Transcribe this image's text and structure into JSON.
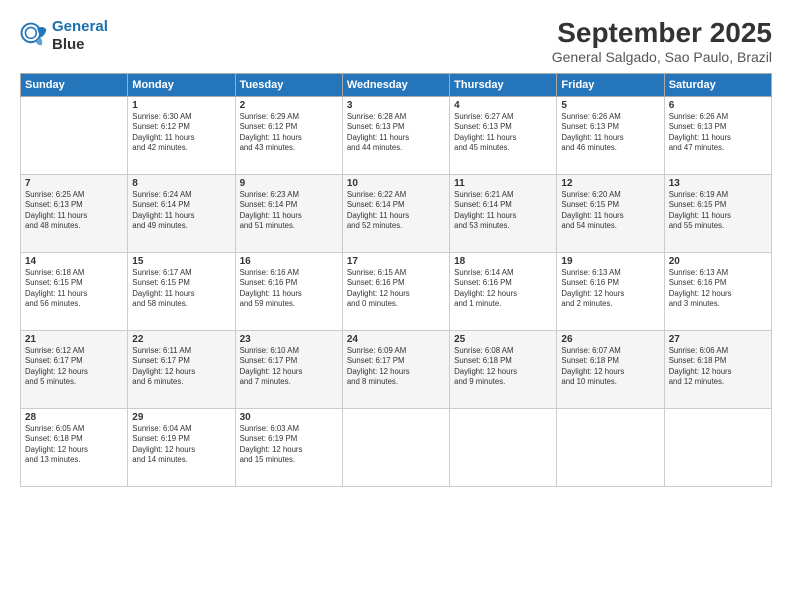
{
  "header": {
    "logo_line1": "General",
    "logo_line2": "Blue",
    "month": "September 2025",
    "location": "General Salgado, Sao Paulo, Brazil"
  },
  "days_of_week": [
    "Sunday",
    "Monday",
    "Tuesday",
    "Wednesday",
    "Thursday",
    "Friday",
    "Saturday"
  ],
  "weeks": [
    [
      {
        "day": "",
        "content": ""
      },
      {
        "day": "1",
        "content": "Sunrise: 6:30 AM\nSunset: 6:12 PM\nDaylight: 11 hours\nand 42 minutes."
      },
      {
        "day": "2",
        "content": "Sunrise: 6:29 AM\nSunset: 6:12 PM\nDaylight: 11 hours\nand 43 minutes."
      },
      {
        "day": "3",
        "content": "Sunrise: 6:28 AM\nSunset: 6:13 PM\nDaylight: 11 hours\nand 44 minutes."
      },
      {
        "day": "4",
        "content": "Sunrise: 6:27 AM\nSunset: 6:13 PM\nDaylight: 11 hours\nand 45 minutes."
      },
      {
        "day": "5",
        "content": "Sunrise: 6:26 AM\nSunset: 6:13 PM\nDaylight: 11 hours\nand 46 minutes."
      },
      {
        "day": "6",
        "content": "Sunrise: 6:26 AM\nSunset: 6:13 PM\nDaylight: 11 hours\nand 47 minutes."
      }
    ],
    [
      {
        "day": "7",
        "content": "Sunrise: 6:25 AM\nSunset: 6:13 PM\nDaylight: 11 hours\nand 48 minutes."
      },
      {
        "day": "8",
        "content": "Sunrise: 6:24 AM\nSunset: 6:14 PM\nDaylight: 11 hours\nand 49 minutes."
      },
      {
        "day": "9",
        "content": "Sunrise: 6:23 AM\nSunset: 6:14 PM\nDaylight: 11 hours\nand 51 minutes."
      },
      {
        "day": "10",
        "content": "Sunrise: 6:22 AM\nSunset: 6:14 PM\nDaylight: 11 hours\nand 52 minutes."
      },
      {
        "day": "11",
        "content": "Sunrise: 6:21 AM\nSunset: 6:14 PM\nDaylight: 11 hours\nand 53 minutes."
      },
      {
        "day": "12",
        "content": "Sunrise: 6:20 AM\nSunset: 6:15 PM\nDaylight: 11 hours\nand 54 minutes."
      },
      {
        "day": "13",
        "content": "Sunrise: 6:19 AM\nSunset: 6:15 PM\nDaylight: 11 hours\nand 55 minutes."
      }
    ],
    [
      {
        "day": "14",
        "content": "Sunrise: 6:18 AM\nSunset: 6:15 PM\nDaylight: 11 hours\nand 56 minutes."
      },
      {
        "day": "15",
        "content": "Sunrise: 6:17 AM\nSunset: 6:15 PM\nDaylight: 11 hours\nand 58 minutes."
      },
      {
        "day": "16",
        "content": "Sunrise: 6:16 AM\nSunset: 6:16 PM\nDaylight: 11 hours\nand 59 minutes."
      },
      {
        "day": "17",
        "content": "Sunrise: 6:15 AM\nSunset: 6:16 PM\nDaylight: 12 hours\nand 0 minutes."
      },
      {
        "day": "18",
        "content": "Sunrise: 6:14 AM\nSunset: 6:16 PM\nDaylight: 12 hours\nand 1 minute."
      },
      {
        "day": "19",
        "content": "Sunrise: 6:13 AM\nSunset: 6:16 PM\nDaylight: 12 hours\nand 2 minutes."
      },
      {
        "day": "20",
        "content": "Sunrise: 6:13 AM\nSunset: 6:16 PM\nDaylight: 12 hours\nand 3 minutes."
      }
    ],
    [
      {
        "day": "21",
        "content": "Sunrise: 6:12 AM\nSunset: 6:17 PM\nDaylight: 12 hours\nand 5 minutes."
      },
      {
        "day": "22",
        "content": "Sunrise: 6:11 AM\nSunset: 6:17 PM\nDaylight: 12 hours\nand 6 minutes."
      },
      {
        "day": "23",
        "content": "Sunrise: 6:10 AM\nSunset: 6:17 PM\nDaylight: 12 hours\nand 7 minutes."
      },
      {
        "day": "24",
        "content": "Sunrise: 6:09 AM\nSunset: 6:17 PM\nDaylight: 12 hours\nand 8 minutes."
      },
      {
        "day": "25",
        "content": "Sunrise: 6:08 AM\nSunset: 6:18 PM\nDaylight: 12 hours\nand 9 minutes."
      },
      {
        "day": "26",
        "content": "Sunrise: 6:07 AM\nSunset: 6:18 PM\nDaylight: 12 hours\nand 10 minutes."
      },
      {
        "day": "27",
        "content": "Sunrise: 6:06 AM\nSunset: 6:18 PM\nDaylight: 12 hours\nand 12 minutes."
      }
    ],
    [
      {
        "day": "28",
        "content": "Sunrise: 6:05 AM\nSunset: 6:18 PM\nDaylight: 12 hours\nand 13 minutes."
      },
      {
        "day": "29",
        "content": "Sunrise: 6:04 AM\nSunset: 6:19 PM\nDaylight: 12 hours\nand 14 minutes."
      },
      {
        "day": "30",
        "content": "Sunrise: 6:03 AM\nSunset: 6:19 PM\nDaylight: 12 hours\nand 15 minutes."
      },
      {
        "day": "",
        "content": ""
      },
      {
        "day": "",
        "content": ""
      },
      {
        "day": "",
        "content": ""
      },
      {
        "day": "",
        "content": ""
      }
    ]
  ]
}
